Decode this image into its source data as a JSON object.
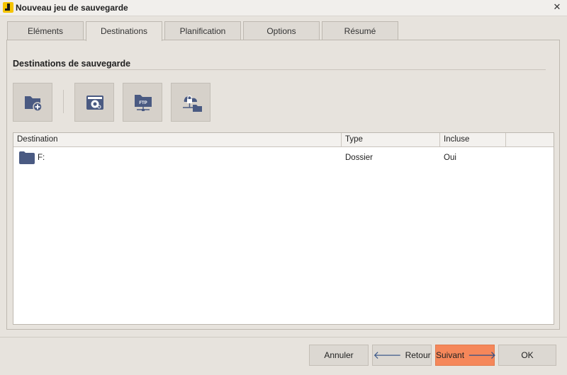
{
  "window": {
    "title": "Nouveau jeu de sauvegarde",
    "close_glyph": "✕",
    "accent": "#f5c400"
  },
  "tabs": [
    {
      "label": "Eléments",
      "active": false
    },
    {
      "label": "Destinations",
      "active": true
    },
    {
      "label": "Planification",
      "active": false
    },
    {
      "label": "Options",
      "active": false
    },
    {
      "label": "Résumé",
      "active": false
    }
  ],
  "section": {
    "title": "Destinations de sauvegarde"
  },
  "toolbar": [
    {
      "icon": "add-folder-icon"
    },
    {
      "icon": "disc-drive-icon"
    },
    {
      "icon": "ftp-folder-icon"
    },
    {
      "icon": "secure-network-folder-icon"
    }
  ],
  "table": {
    "columns": [
      "Destination",
      "Type",
      "Incluse",
      ""
    ],
    "rows": [
      {
        "icon": "folder-icon",
        "destination": "F:",
        "type": "Dossier",
        "included": "Oui"
      }
    ]
  },
  "buttons": {
    "cancel": "Annuler",
    "back": "Retour",
    "next": "Suivant",
    "ok": "OK",
    "back_arrow": "🡐",
    "next_arrow": "🡒",
    "primary_color": "#f5875a"
  }
}
